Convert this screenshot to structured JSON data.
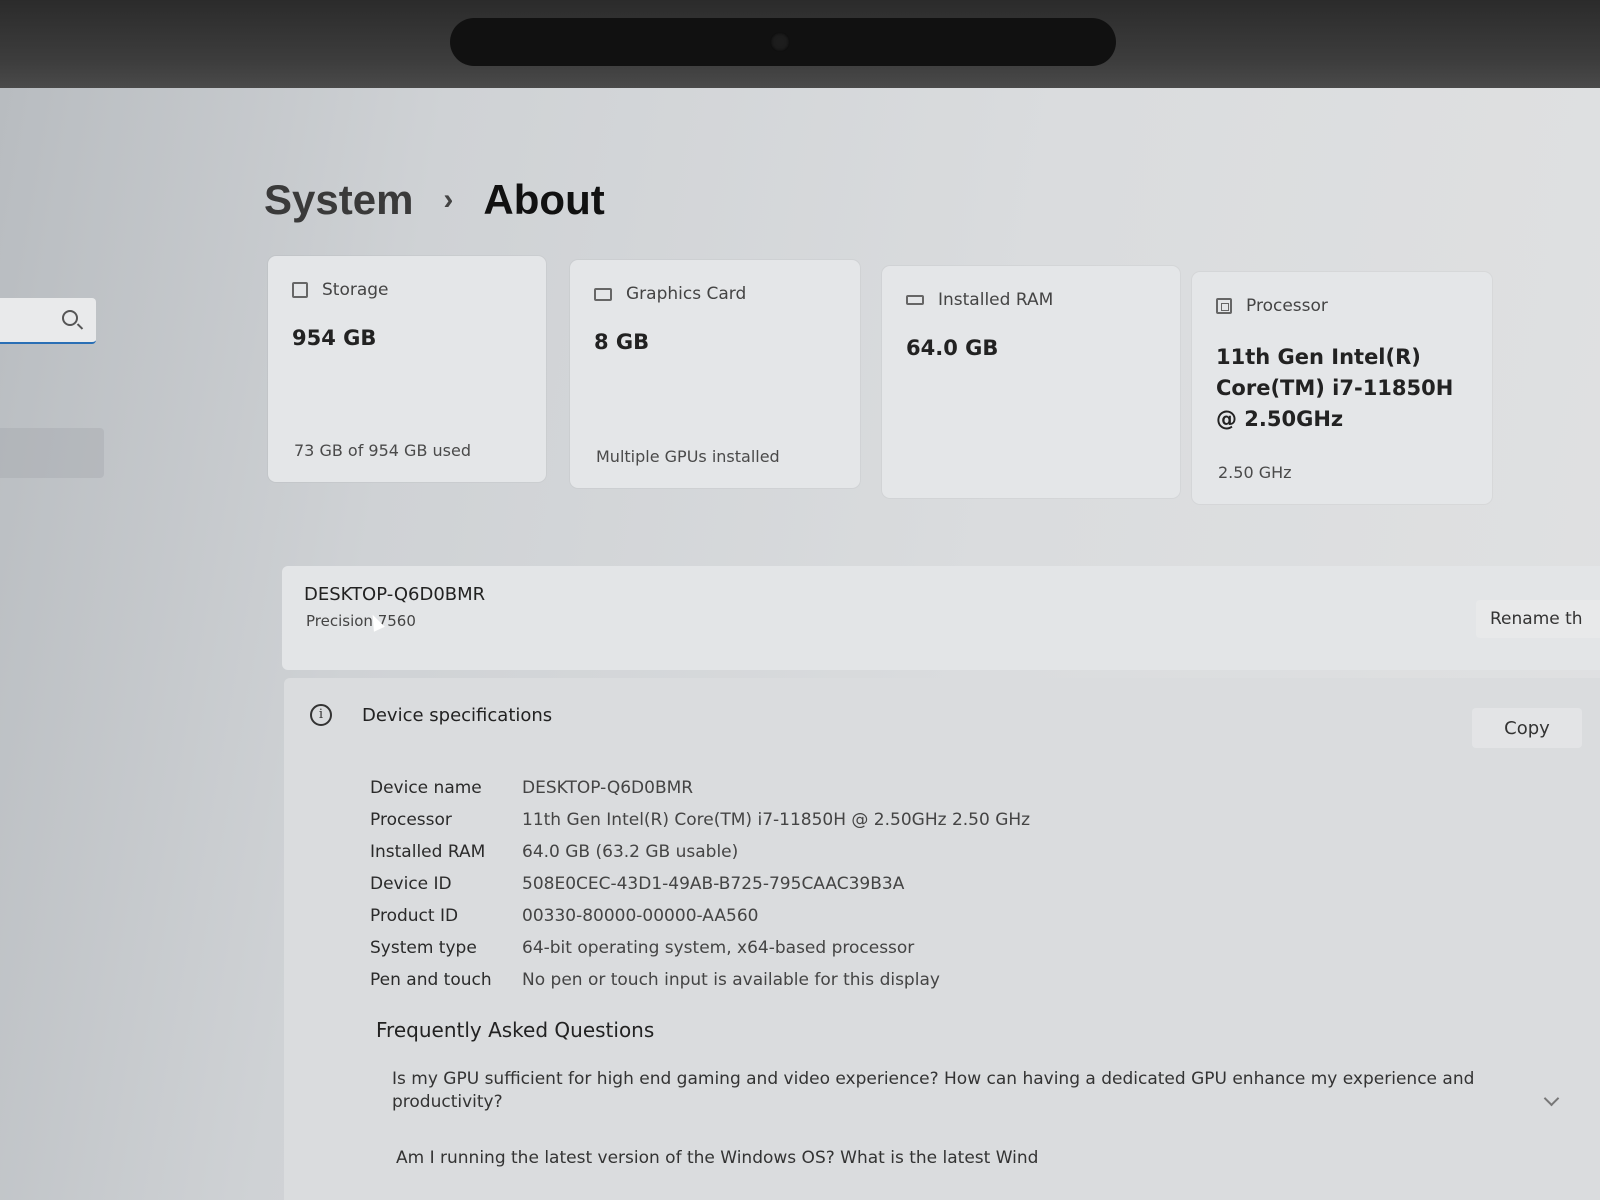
{
  "breadcrumb": {
    "parent": "System",
    "separator": "›",
    "current": "About"
  },
  "tiles": [
    {
      "label": "Storage",
      "value": "954 GB",
      "footer": "73 GB of 954 GB used",
      "icon": "storage-icon"
    },
    {
      "label": "Graphics Card",
      "value": "8 GB",
      "footer": "Multiple GPUs installed",
      "icon": "graphics-card-icon"
    },
    {
      "label": "Installed RAM",
      "value": "64.0 GB",
      "footer": "",
      "icon": "ram-icon"
    },
    {
      "label": "Processor",
      "value": "11th Gen Intel(R) Core(TM) i7-11850H @ 2.50GHz",
      "footer": "2.50 GHz",
      "icon": "processor-icon"
    }
  ],
  "device": {
    "name": "DESKTOP-Q6D0BMR",
    "model": "Precision 7560",
    "rename_label": "Rename th"
  },
  "specs": {
    "title": "Device specifications",
    "copy_label": "Copy",
    "rows": [
      {
        "label": "Device name",
        "value": "DESKTOP-Q6D0BMR"
      },
      {
        "label": "Processor",
        "value": "11th Gen Intel(R) Core(TM) i7-11850H @ 2.50GHz   2.50 GHz"
      },
      {
        "label": "Installed RAM",
        "value": "64.0 GB (63.2 GB usable)"
      },
      {
        "label": "Device ID",
        "value": "508E0CEC-43D1-49AB-B725-795CAAC39B3A"
      },
      {
        "label": "Product ID",
        "value": "00330-80000-00000-AA560"
      },
      {
        "label": "System type",
        "value": "64-bit operating system, x64-based processor"
      },
      {
        "label": "Pen and touch",
        "value": "No pen or touch input is available for this display"
      }
    ]
  },
  "faq": {
    "title": "Frequently Asked Questions",
    "q1": "Is my GPU sufficient for high end gaming and video experience? How can having a dedicated GPU enhance my experience and productivity?",
    "q2": "Am I running the latest version of the Windows OS? What is the latest Wind"
  }
}
